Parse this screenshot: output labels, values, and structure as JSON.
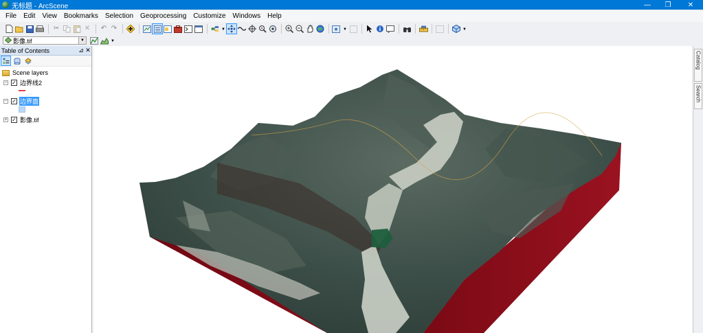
{
  "window": {
    "title": "无标题 - ArcScene",
    "minimize": "—",
    "maximize": "❐",
    "close": "✕"
  },
  "menu": [
    "File",
    "Edit",
    "View",
    "Bookmarks",
    "Selection",
    "Geoprocessing",
    "Customize",
    "Windows",
    "Help"
  ],
  "layer_selector": {
    "value": "影像.tif"
  },
  "toc": {
    "title": "Table of Contents",
    "pin": "⊿",
    "close": "✕",
    "root": "Scene layers",
    "layers": [
      {
        "name": "边界线2",
        "checked": true,
        "expanded": true,
        "legend": "line",
        "legend_color": "#e04040"
      },
      {
        "name": "边界面",
        "checked": true,
        "expanded": true,
        "legend": "fill",
        "legend_color": "#bcd7f5",
        "selected": true
      },
      {
        "name": "影像.tif",
        "checked": true,
        "expanded": false
      }
    ]
  },
  "right_dock": {
    "catalog": "Catalog",
    "search": "Search"
  },
  "colors": {
    "titlebar": "#0078d7",
    "extrusion_side": "#8b0d18",
    "terrain_dark": "#3d4f49",
    "riverbed": "#c9cdc2",
    "selection": "#3399ff"
  },
  "icons": {
    "standard": [
      "new-document-icon",
      "open-icon",
      "save-icon",
      "print-icon",
      "cut-icon",
      "copy-icon",
      "paste-icon",
      "delete-icon",
      "undo-icon",
      "redo-icon",
      "add-data-icon"
    ],
    "scene_tools": [
      "table-of-contents-icon",
      "catalog-window-icon",
      "arctoolbox-icon",
      "python-icon",
      "search-window-icon",
      "model-builder-icon"
    ],
    "navigation": [
      "navigate-icon",
      "fly-icon",
      "target-center-icon",
      "zoom-to-target-icon",
      "set-observer-icon",
      "zoom-in-icon",
      "zoom-out-icon",
      "pan-icon",
      "full-extent-icon"
    ],
    "tools": [
      "select-features-icon",
      "identify-icon",
      "html-popup-icon",
      "find-icon",
      "measure-icon",
      "animation-icon",
      "3d-effects-icon"
    ]
  }
}
